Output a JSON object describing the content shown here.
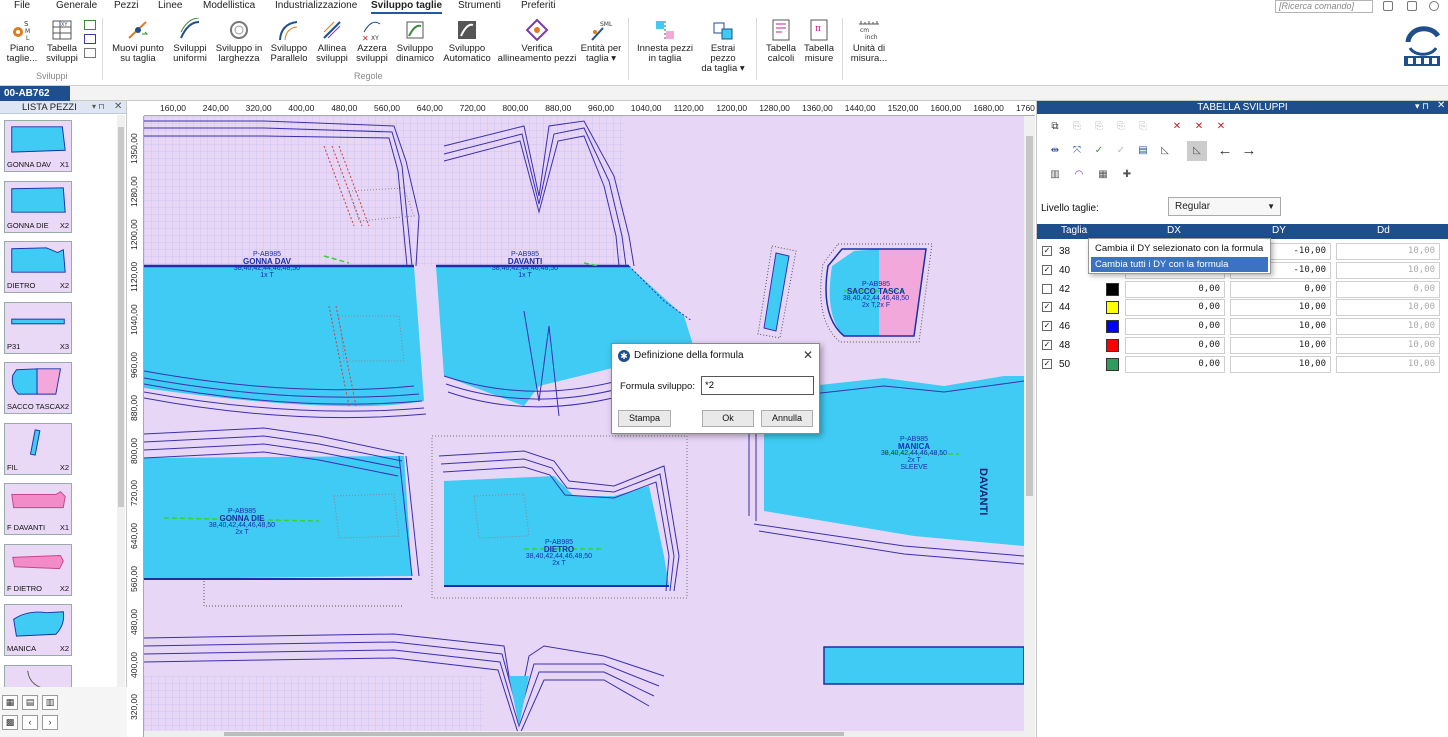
{
  "menu": {
    "items": [
      "File",
      "Generale",
      "Pezzi",
      "Linee",
      "Modellistica",
      "Industrializzazione",
      "Sviluppo taglie",
      "Strumenti",
      "Preferiti"
    ],
    "active": "Sviluppo taglie",
    "search_placeholder": "[Ricerca comando]"
  },
  "ribbon": {
    "buttons": [
      {
        "label": "Piano\ntaglie...",
        "icon": "size-plan-icon"
      },
      {
        "label": "Tabella\nsviluppi",
        "icon": "grading-table-icon"
      },
      {
        "label": "Muovi punto\nsu taglia",
        "icon": "move-point-icon"
      },
      {
        "label": "Sviluppi\nuniformi",
        "icon": "uniform-grading-icon"
      },
      {
        "label": "Sviluppo in\nlarghezza",
        "icon": "width-grading-icon"
      },
      {
        "label": "Sviluppo\nParallelo",
        "icon": "parallel-grading-icon"
      },
      {
        "label": "Allinea\nsviluppi",
        "icon": "align-grading-icon"
      },
      {
        "label": "Azzera\nsviluppi",
        "icon": "reset-grading-icon"
      },
      {
        "label": "Sviluppo\ndinamico",
        "icon": "dynamic-grading-icon"
      },
      {
        "label": "Sviluppo\nAutomatico",
        "icon": "auto-grading-icon"
      },
      {
        "label": "Verifica\nallineamento pezzi",
        "icon": "verify-alignment-icon"
      },
      {
        "label": "Entità per\ntaglia ▾",
        "icon": "size-entities-icon"
      },
      {
        "label": "Innesta pezzi\nin taglia",
        "icon": "graft-pieces-icon"
      },
      {
        "label": "Estrai pezzo\nda taglia ▾",
        "icon": "extract-piece-icon"
      },
      {
        "label": "Tabella\ncalcoli",
        "icon": "calc-table-icon"
      },
      {
        "label": "Tabella\nmisure",
        "icon": "measure-table-icon"
      },
      {
        "label": "Unità di\nmisura...",
        "icon": "units-icon"
      }
    ],
    "groups": [
      "Sviluppi",
      "Regole"
    ]
  },
  "document_tab": "00-AB762",
  "left_panel": {
    "title": "LISTA PEZZI",
    "pieces": [
      {
        "name": "GONNA DAV",
        "qty": "X1",
        "shape": "skirt-front"
      },
      {
        "name": "GONNA DIE",
        "qty": "X2",
        "shape": "skirt-back"
      },
      {
        "name": "DIETRO",
        "qty": "X2",
        "shape": "back"
      },
      {
        "name": "P31",
        "qty": "X3",
        "shape": "strip"
      },
      {
        "name": "SACCO TASCA",
        "qty": "X2",
        "shape": "pocket"
      },
      {
        "name": "FIL",
        "qty": "X2",
        "shape": "fil"
      },
      {
        "name": "F DAVANTI",
        "qty": "X1",
        "shape": "facing-front"
      },
      {
        "name": "F DIETRO",
        "qty": "X2",
        "shape": "facing-back"
      },
      {
        "name": "MANICA",
        "qty": "X2",
        "shape": "sleeve"
      }
    ]
  },
  "rulers": {
    "top": [
      "160,00",
      "240,00",
      "320,00",
      "400,00",
      "480,00",
      "560,00",
      "640,00",
      "720,00",
      "800,00",
      "880,00",
      "960,00",
      "1040,00",
      "1120,00",
      "1200,00",
      "1280,00",
      "1360,00",
      "1440,00",
      "1520,00",
      "1600,00",
      "1680,00",
      "1760"
    ],
    "left": [
      "1350,00",
      "1280,00",
      "1200,00",
      "1120,00",
      "1040,00",
      "960,00",
      "880,00",
      "800,00",
      "720,00",
      "640,00",
      "560,00",
      "480,00",
      "400,00",
      "320,00"
    ]
  },
  "canvas_pieces": [
    {
      "code": "P-AB985",
      "name": "GONNA DAV",
      "sizes": "38,40,42,44,46,48,50",
      "qty": "1x T"
    },
    {
      "code": "P-AB985",
      "name": "DAVANTI",
      "sizes": "38,40,42,44,46,48,50",
      "qty": "1x T"
    },
    {
      "code": "P-AB985",
      "name": "SACCO TASCA",
      "sizes": "38,40,42,44,46,48,50",
      "qty": "2x T,2x F"
    },
    {
      "code": "P-AB985",
      "name": "GONNA DIE",
      "sizes": "38,40,42,44,46,48,50",
      "qty": "2x T"
    },
    {
      "code": "P-AB985",
      "name": "DIETRO",
      "sizes": "38,40,42,44,46,48,50",
      "qty": "2x T"
    },
    {
      "code": "P-AB985",
      "name": "MANICA",
      "sizes": "38,40,42,44,46,48,50",
      "qty": "2x T",
      "extra": "SLEEVE"
    }
  ],
  "canvas_vertical_label": "DAVANTI",
  "dialog": {
    "title": "Definizione della formula",
    "field_label": "Formula sviluppo:",
    "field_value": "*2",
    "buttons": [
      "Stampa",
      "Ok",
      "Annulla"
    ]
  },
  "right_panel": {
    "title": "TABELLA SVILUPPI",
    "size_level_label": "Livello taglie:",
    "size_level_value": "Regular",
    "columns": [
      "Taglia",
      "DX",
      "DY",
      "Dd"
    ],
    "rows": [
      {
        "size": "38",
        "checked": true,
        "color": "#ffffff",
        "dx": "",
        "dy": "-10,00",
        "dd": "10,00"
      },
      {
        "size": "40",
        "checked": true,
        "color": "#ffffff",
        "dx": "",
        "dy": "-10,00",
        "dd": "10,00"
      },
      {
        "size": "42",
        "checked": false,
        "color": "#000000",
        "dx": "0,00",
        "dy": "0,00",
        "dd": "0,00"
      },
      {
        "size": "44",
        "checked": true,
        "color": "#ffff00",
        "dx": "0,00",
        "dy": "10,00",
        "dd": "10,00"
      },
      {
        "size": "46",
        "checked": true,
        "color": "#0000ff",
        "dx": "0,00",
        "dy": "10,00",
        "dd": "10,00"
      },
      {
        "size": "48",
        "checked": true,
        "color": "#ff0000",
        "dx": "0,00",
        "dy": "10,00",
        "dd": "10,00"
      },
      {
        "size": "50",
        "checked": true,
        "color": "#2e9c5a",
        "dx": "0,00",
        "dy": "10,00",
        "dd": "10,00"
      }
    ]
  },
  "context_menu": {
    "items": [
      "Cambia il DY selezionato con la formula",
      "Cambia tutti i DY con la formula"
    ],
    "highlighted": 1
  },
  "colors": {
    "accent": "#1f4e8c",
    "canvas_bg": "#e8d6f7",
    "piece_fill": "#3fcbf4",
    "grading_lines": "#3a2fb0",
    "pocket_pink": "#f2a8da"
  }
}
